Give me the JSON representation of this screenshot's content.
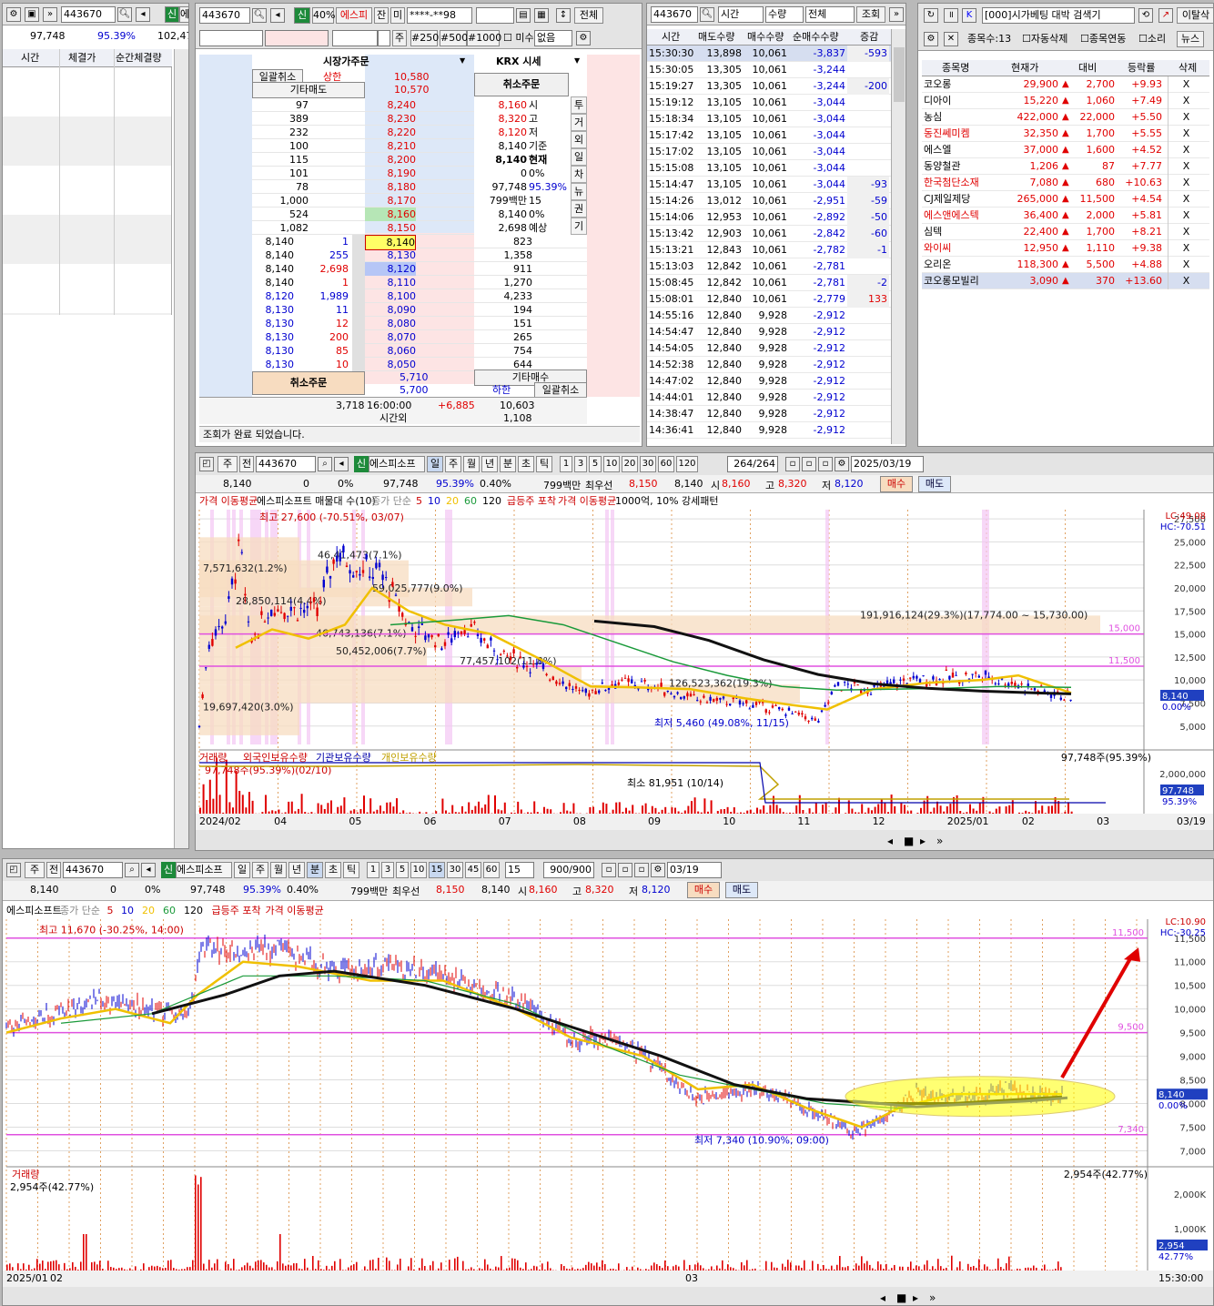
{
  "ticks": {
    "code": "443670",
    "tab_realtime": "신",
    "tab_short": "에",
    "vol": "97,748",
    "pct": "95.39%",
    "cum": "102,47",
    "headers": [
      "시간",
      "체결가",
      "순간체결량"
    ]
  },
  "order": {
    "code": "443670",
    "badge": "신",
    "pct": "40%",
    "name": "에스피",
    "b1": "잔",
    "b2": "미",
    "acct": "****-**98",
    "all": "전체",
    "opts": [
      "주",
      "#250",
      "#500",
      "#1000",
      "미수",
      "없음"
    ],
    "hdr_market": "시장가주문",
    "hdr_krx": "KRX 시세",
    "cancel_all": "일괄취소",
    "upper": "상한",
    "upper_px": "10,580",
    "other_sell": "기타매도",
    "other_sell_px": "10,570",
    "cancel_order": "취소주문",
    "asks": [
      [
        "97",
        "8,240"
      ],
      [
        "389",
        "8,230"
      ],
      [
        "232",
        "8,220"
      ],
      [
        "100",
        "8,210"
      ],
      [
        "115",
        "8,200"
      ],
      [
        "101",
        "8,190"
      ],
      [
        "78",
        "8,180"
      ],
      [
        "1,000",
        "8,170"
      ],
      [
        "524",
        "8,160"
      ],
      [
        "1,082",
        "8,150"
      ]
    ],
    "info": [
      [
        "8,160",
        "시"
      ],
      [
        "8,320",
        "고"
      ],
      [
        "8,120",
        "저"
      ],
      [
        "8,140",
        "기준"
      ],
      [
        "8,140",
        "현재"
      ],
      [
        "0",
        "0%"
      ],
      [
        "97,748",
        "95.39%"
      ],
      [
        "799백만",
        "15"
      ],
      [
        "8,140",
        "0%"
      ],
      [
        "2,698",
        "예상"
      ]
    ],
    "vtabs": [
      "투",
      "거",
      "외",
      "일",
      "차",
      "뉴",
      "권",
      "기"
    ],
    "ticks": [
      [
        "8,140",
        "1"
      ],
      [
        "8,140",
        "255"
      ],
      [
        "8,140",
        "2,698"
      ],
      [
        "8,140",
        "1"
      ],
      [
        "8,120",
        "1,989"
      ],
      [
        "8,130",
        "11"
      ],
      [
        "8,130",
        "12"
      ],
      [
        "8,130",
        "200"
      ],
      [
        "8,130",
        "85"
      ],
      [
        "8,130",
        "10"
      ]
    ],
    "bids": [
      [
        "8,140",
        "823"
      ],
      [
        "8,130",
        "1,358"
      ],
      [
        "8,120",
        "911"
      ],
      [
        "8,110",
        "1,270"
      ],
      [
        "8,100",
        "4,233"
      ],
      [
        "8,090",
        "194"
      ],
      [
        "8,080",
        "151"
      ],
      [
        "8,070",
        "265"
      ],
      [
        "8,060",
        "754"
      ],
      [
        "8,050",
        "644"
      ]
    ],
    "lower_other": "5,710",
    "other_buy": "기타매수",
    "lower": "하한",
    "lower_px": "5,700",
    "cancel_all2": "일괄취소",
    "tot_ask": "3,718",
    "time": "16:00:00",
    "diff": "+6,885",
    "tot_bid": "10,603",
    "afterhrs": "시간외",
    "afterhrs_val": "1,108",
    "status": "조회가 완료 되었습니다."
  },
  "timevol": {
    "code": "443670",
    "sel1": "시간",
    "sel2": "수량",
    "sel3": "전체",
    "query": "조회",
    "headers": [
      "시간",
      "매도수량",
      "매수수량",
      "순매수수량",
      "증감"
    ],
    "rows": [
      [
        "15:30:30",
        "13,898",
        "10,061",
        "-3,837",
        "-593"
      ],
      [
        "15:30:05",
        "13,305",
        "10,061",
        "-3,244",
        ""
      ],
      [
        "15:19:27",
        "13,305",
        "10,061",
        "-3,244",
        "-200"
      ],
      [
        "15:19:12",
        "13,105",
        "10,061",
        "-3,044",
        ""
      ],
      [
        "15:18:34",
        "13,105",
        "10,061",
        "-3,044",
        ""
      ],
      [
        "15:17:42",
        "13,105",
        "10,061",
        "-3,044",
        ""
      ],
      [
        "15:17:02",
        "13,105",
        "10,061",
        "-3,044",
        ""
      ],
      [
        "15:15:08",
        "13,105",
        "10,061",
        "-3,044",
        ""
      ],
      [
        "15:14:47",
        "13,105",
        "10,061",
        "-3,044",
        "-93"
      ],
      [
        "15:14:26",
        "13,012",
        "10,061",
        "-2,951",
        "-59"
      ],
      [
        "15:14:06",
        "12,953",
        "10,061",
        "-2,892",
        "-50"
      ],
      [
        "15:13:42",
        "12,903",
        "10,061",
        "-2,842",
        "-60"
      ],
      [
        "15:13:21",
        "12,843",
        "10,061",
        "-2,782",
        "-1"
      ],
      [
        "15:13:03",
        "12,842",
        "10,061",
        "-2,781",
        ""
      ],
      [
        "15:08:45",
        "12,842",
        "10,061",
        "-2,781",
        "-2"
      ],
      [
        "15:08:01",
        "12,840",
        "10,061",
        "-2,779",
        "133"
      ],
      [
        "14:55:16",
        "12,840",
        "9,928",
        "-2,912",
        ""
      ],
      [
        "14:54:47",
        "12,840",
        "9,928",
        "-2,912",
        ""
      ],
      [
        "14:54:05",
        "12,840",
        "9,928",
        "-2,912",
        ""
      ],
      [
        "14:52:38",
        "12,840",
        "9,928",
        "-2,912",
        ""
      ],
      [
        "14:47:02",
        "12,840",
        "9,928",
        "-2,912",
        ""
      ],
      [
        "14:44:01",
        "12,840",
        "9,928",
        "-2,912",
        ""
      ],
      [
        "14:38:47",
        "12,840",
        "9,928",
        "-2,912",
        ""
      ],
      [
        "14:36:41",
        "12,840",
        "9,928",
        "-2,912",
        ""
      ]
    ]
  },
  "search": {
    "title": "[000]시가베팅 대박 검색기",
    "stop_label": "이탈삭",
    "count": "종목수:13",
    "cb1": "자동삭제",
    "cb2": "종목연동",
    "cb3": "소리",
    "news": "뉴스",
    "headers": [
      "종목명",
      "현재가",
      "대비",
      "등락률",
      "삭제"
    ],
    "rows": [
      [
        "코오롱",
        "29,900",
        "2,700",
        "+9.93",
        "X"
      ],
      [
        "디아이",
        "15,220",
        "1,060",
        "+7.49",
        "X"
      ],
      [
        "농심",
        "422,000",
        "22,000",
        "+5.50",
        "X"
      ],
      [
        "동진쎄미켐",
        "32,350",
        "1,700",
        "+5.55",
        "X"
      ],
      [
        "에스엘",
        "37,000",
        "1,600",
        "+4.52",
        "X"
      ],
      [
        "동양철관",
        "1,206",
        "87",
        "+7.77",
        "X"
      ],
      [
        "한국첨단소재",
        "7,080",
        "680",
        "+10.63",
        "X"
      ],
      [
        "CJ제일제당",
        "265,000",
        "11,500",
        "+4.54",
        "X"
      ],
      [
        "에스앤에스텍",
        "36,400",
        "2,000",
        "+5.81",
        "X"
      ],
      [
        "심텍",
        "22,400",
        "1,700",
        "+8.21",
        "X"
      ],
      [
        "와이씨",
        "12,950",
        "1,110",
        "+9.38",
        "X"
      ],
      [
        "오리온",
        "118,300",
        "5,500",
        "+4.88",
        "X"
      ],
      [
        "코오롱모빌리",
        "3,090",
        "370",
        "+13.60",
        "X"
      ]
    ]
  },
  "daily": {
    "tb": {
      "cycle": "주",
      "prev": "전",
      "code": "443670",
      "badge": "신",
      "name": "에스피소프",
      "periods": [
        "일",
        "주",
        "월",
        "년",
        "분",
        "초",
        "틱"
      ],
      "nums": [
        "1",
        "3",
        "5",
        "10",
        "20",
        "30",
        "60",
        "120"
      ],
      "count": "264/264",
      "date": "2025/03/19"
    },
    "info": {
      "price": "8,140",
      "chg": "0",
      "pct": "0%",
      "vol": "97,748",
      "vpct": "95.39%",
      "turn": "0.40%",
      "amt": "799백만",
      "best": "최우선",
      "b1": "8,150",
      "b2": "8,140",
      "o": "시",
      "ov": "8,160",
      "h": "고",
      "hv": "8,320",
      "l": "저",
      "lv": "8,120",
      "buy": "매수",
      "sell": "매도"
    },
    "legend": [
      "가격 이동평균",
      "에스피소프트 매물대 수(10)",
      "종가 단순",
      "5",
      "10",
      "20",
      "60",
      "120",
      "급등주 포착",
      "가격 이동평균",
      "1000억, 10% 강세패턴"
    ],
    "lc": "LC:49.08",
    "hc": "HC:-70.51",
    "yticks": [
      "27,500",
      "25,000",
      "22,500",
      "20,000",
      "17,500",
      "15,000",
      "12,500",
      "10,000",
      "7,500",
      "5,000"
    ],
    "bands": [
      "7,571,632(1.2%)",
      "46,41,473(7.1%)",
      "59,025,777(9.0%)",
      "28,850,114(4.4%)",
      "46,743,136(7.1%)",
      "50,452,006(7.7%)",
      "77,457,102(11.8%)",
      "126,523,362(19.3%)",
      "19,697,420(3.0%)",
      "191,916,124(29.3%)(17,774.00 ~ 15,730.00)"
    ],
    "high_note": "최고 27,600 (-70.51%, 03/07)",
    "low_note": "최저 5,460 (49.08%, 11/15)",
    "hl15": "15,000",
    "hl115": "11,500",
    "cur": "8,140",
    "cur_pct": "0.00%",
    "vol_legend": [
      "거래량",
      "외국인보유수량",
      "기관보유수량",
      "개인보유수량"
    ],
    "vol_note": "97,748주(95.39%)",
    "vol_min": "최소 81,951 (10/14)",
    "vol_tick": "2,000,000",
    "vol_cur": "97,748",
    "vol_curpct": "95.39%",
    "vol_left": "97,748주(95.39%)(02/10)",
    "xlabels": [
      "2024/02",
      "04",
      "05",
      "06",
      "07",
      "08",
      "09",
      "10",
      "11",
      "12",
      "2025/01",
      "02",
      "03",
      "03/19"
    ]
  },
  "intraday": {
    "tb": {
      "cycle": "주",
      "prev": "전",
      "code": "443670",
      "badge": "신",
      "name": "에스피소프",
      "periods": [
        "일",
        "주",
        "월",
        "년",
        "분",
        "초",
        "틱"
      ],
      "nums": [
        "1",
        "3",
        "5",
        "10",
        "15",
        "30",
        "45",
        "60"
      ],
      "sel": "15",
      "count": "900/900",
      "date": "03/19"
    },
    "info": {
      "price": "8,140",
      "chg": "0",
      "pct": "0%",
      "vol": "97,748",
      "vpct": "95.39%",
      "turn": "0.40%",
      "amt": "799백만",
      "best": "최우선",
      "b1": "8,150",
      "b2": "8,140",
      "o": "시",
      "ov": "8,160",
      "h": "고",
      "hv": "8,320",
      "l": "저",
      "lv": "8,120",
      "buy": "매수",
      "sell": "매도"
    },
    "legend": [
      "에스피소프트",
      "종가 단순",
      "5",
      "10",
      "20",
      "60",
      "120",
      "급등주 포착",
      "가격 이동평균"
    ],
    "lc": "LC:10.90",
    "hc": "HC:-30.25",
    "yticks": [
      "11,500",
      "11,000",
      "10,500",
      "10,000",
      "9,500",
      "9,000",
      "8,500",
      "8,000",
      "7,500",
      "7,000"
    ],
    "high_note": "최고 11,670 (-30.25%, 14:00)",
    "low_note": "최저 7,340 (10.90%, 09:00)",
    "hl1": "11,500",
    "hl2": "9,500",
    "hl3": "7,340",
    "cur": "8,140",
    "cur_pct": "0.00%",
    "vol_legend": "거래량",
    "vol_note": "2,954주(42.77%)",
    "vol_left": "2,954주(42.77%)",
    "vol_t1": "2,000K",
    "vol_t2": "1,000K",
    "vol_cur": "2,954",
    "vol_curpct": "42.77%",
    "xlabels": [
      "2025/01",
      "02",
      "03",
      "15:30:00"
    ]
  },
  "colors": {
    "up": "#e00000",
    "down": "#0000d0",
    "ma_black": "#111111",
    "ma_yellow": "#f0c000",
    "ma_green": "#1a9a3a",
    "pink": "#e050e0",
    "band": "#f7dcc0"
  }
}
